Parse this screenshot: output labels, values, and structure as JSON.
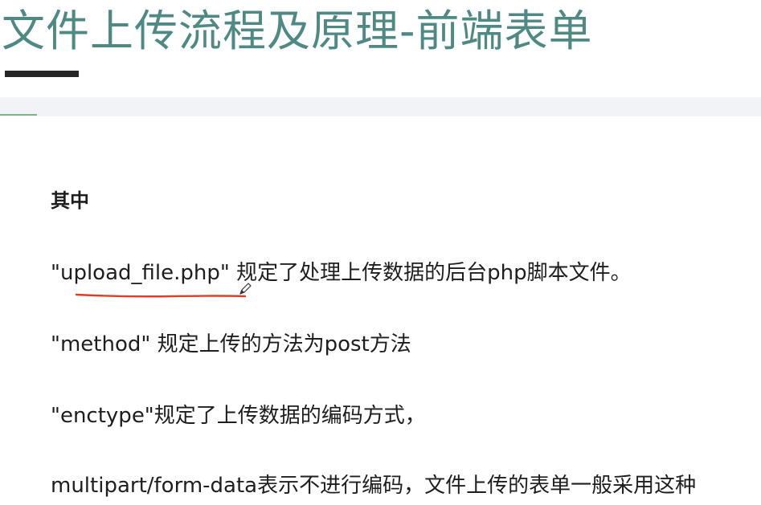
{
  "slide": {
    "title": "文件上传流程及原理-前端表单"
  },
  "content": {
    "heading": "其中",
    "p1": {
      "code": "\"upload_file.php\"",
      "text": "规定了处理上传数据的后台php脚本文件。"
    },
    "p2": {
      "code": "\"method\"",
      "text": " 规定上传的方法为post方法"
    },
    "p3": {
      "code": "\"enctype\"",
      "text": "规定了上传数据的编码方式，"
    },
    "p4": {
      "code": "multipart/form-data",
      "text": "表示不进行编码，文件上传的表单一般采用这种"
    }
  },
  "colors": {
    "title": "#4e8a83",
    "underline": "#d9412b",
    "band": "#f2f3f7",
    "accent": "#7fb38a"
  },
  "icons": {
    "cursor": "pen-cursor-icon"
  }
}
